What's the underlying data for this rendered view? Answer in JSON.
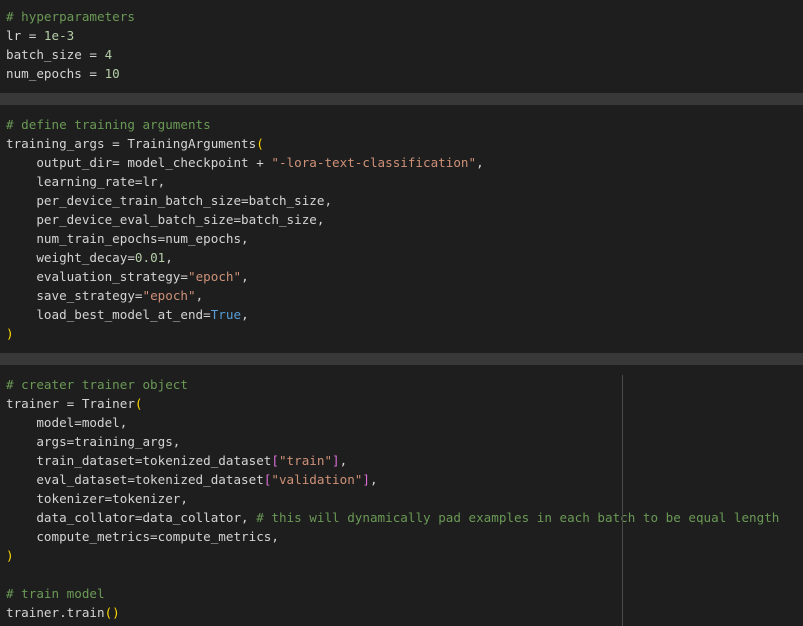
{
  "colors": {
    "background": "#1e1e1e",
    "separator": "#383838",
    "guide": "#4a4a4a",
    "plain": "#d4d4d4",
    "comment": "#6a9955",
    "number": "#b5cea8",
    "string": "#ce9178",
    "paren": "#ffd700",
    "bracket": "#da70d6",
    "keyword": "#569cd6"
  },
  "cells": [
    {
      "lines": [
        [
          [
            "# hyperparameters",
            "comment"
          ]
        ],
        [
          [
            "lr = ",
            "plain"
          ],
          [
            "1e-3",
            "number"
          ]
        ],
        [
          [
            "batch_size = ",
            "plain"
          ],
          [
            "4",
            "number"
          ]
        ],
        [
          [
            "num_epochs = ",
            "plain"
          ],
          [
            "10",
            "number"
          ]
        ]
      ]
    },
    {
      "lines": [
        [
          [
            "# define training arguments",
            "comment"
          ]
        ],
        [
          [
            "training_args = TrainingArguments",
            "plain"
          ],
          [
            "(",
            "paren"
          ]
        ],
        [
          [
            "    output_dir= model_checkpoint + ",
            "plain"
          ],
          [
            "\"-lora-text-classification\"",
            "string"
          ],
          [
            ",",
            "plain"
          ]
        ],
        [
          [
            "    learning_rate=lr,",
            "plain"
          ]
        ],
        [
          [
            "    per_device_train_batch_size=batch_size,",
            "plain"
          ]
        ],
        [
          [
            "    per_device_eval_batch_size=batch_size,",
            "plain"
          ]
        ],
        [
          [
            "    num_train_epochs=num_epochs,",
            "plain"
          ]
        ],
        [
          [
            "    weight_decay=",
            "plain"
          ],
          [
            "0.01",
            "number"
          ],
          [
            ",",
            "plain"
          ]
        ],
        [
          [
            "    evaluation_strategy=",
            "plain"
          ],
          [
            "\"epoch\"",
            "string"
          ],
          [
            ",",
            "plain"
          ]
        ],
        [
          [
            "    save_strategy=",
            "plain"
          ],
          [
            "\"epoch\"",
            "string"
          ],
          [
            ",",
            "plain"
          ]
        ],
        [
          [
            "    load_best_model_at_end=",
            "plain"
          ],
          [
            "True",
            "keyword"
          ],
          [
            ",",
            "plain"
          ]
        ],
        [
          [
            ")",
            "paren"
          ]
        ]
      ]
    },
    {
      "lines": [
        [
          [
            "# creater trainer object",
            "comment"
          ]
        ],
        [
          [
            "trainer = Trainer",
            "plain"
          ],
          [
            "(",
            "paren"
          ]
        ],
        [
          [
            "    model=model,",
            "plain"
          ]
        ],
        [
          [
            "    args=training_args,",
            "plain"
          ]
        ],
        [
          [
            "    train_dataset=tokenized_dataset",
            "plain"
          ],
          [
            "[",
            "bracket"
          ],
          [
            "\"train\"",
            "string"
          ],
          [
            "]",
            "bracket"
          ],
          [
            ",",
            "plain"
          ]
        ],
        [
          [
            "    eval_dataset=tokenized_dataset",
            "plain"
          ],
          [
            "[",
            "bracket"
          ],
          [
            "\"validation\"",
            "string"
          ],
          [
            "]",
            "bracket"
          ],
          [
            ",",
            "plain"
          ]
        ],
        [
          [
            "    tokenizer=tokenizer,",
            "plain"
          ]
        ],
        [
          [
            "    data_collator=data_collator, ",
            "plain"
          ],
          [
            "# this will dynamically pad examples in each batch to be equal length",
            "comment"
          ]
        ],
        [
          [
            "    compute_metrics=compute_metrics,",
            "plain"
          ]
        ],
        [
          [
            ")",
            "paren"
          ]
        ],
        [
          [
            "",
            "plain"
          ]
        ],
        [
          [
            "# train model",
            "comment"
          ]
        ],
        [
          [
            "trainer.train",
            "plain"
          ],
          [
            "()",
            "paren"
          ]
        ]
      ]
    }
  ]
}
